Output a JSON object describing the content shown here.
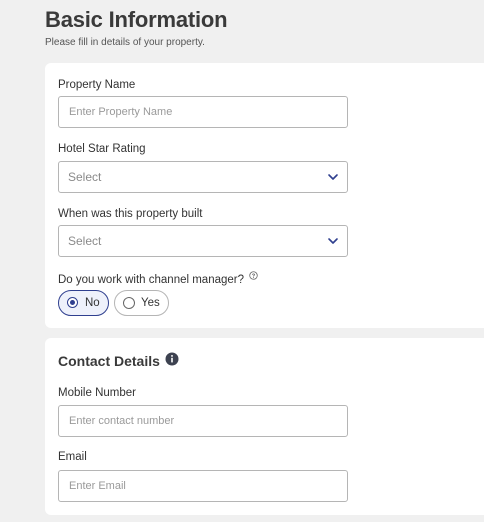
{
  "header": {
    "title": "Basic Information",
    "subtitle": "Please fill in details of your property."
  },
  "basic_info": {
    "property_name": {
      "label": "Property Name",
      "placeholder": "Enter Property Name",
      "value": ""
    },
    "star_rating": {
      "label": "Hotel Star Rating",
      "selected": "Select"
    },
    "year_built": {
      "label": "When was this property built",
      "selected": "Select"
    },
    "channel_manager": {
      "label": "Do you work with channel manager?",
      "options": [
        "No",
        "Yes"
      ],
      "selected": "No"
    }
  },
  "contact": {
    "title": "Contact Details",
    "mobile": {
      "label": "Mobile Number",
      "placeholder": "Enter contact number",
      "value": ""
    },
    "email": {
      "label": "Email",
      "placeholder": "Enter Email",
      "value": ""
    }
  },
  "icons": {
    "dropdown": "chevron-down-icon",
    "help": "question-circle-icon",
    "info": "info-circle-icon"
  },
  "colors": {
    "accent": "#2f3f8f",
    "background": "#f0f0f0",
    "card": "#ffffff",
    "border": "#b5b5b5"
  }
}
